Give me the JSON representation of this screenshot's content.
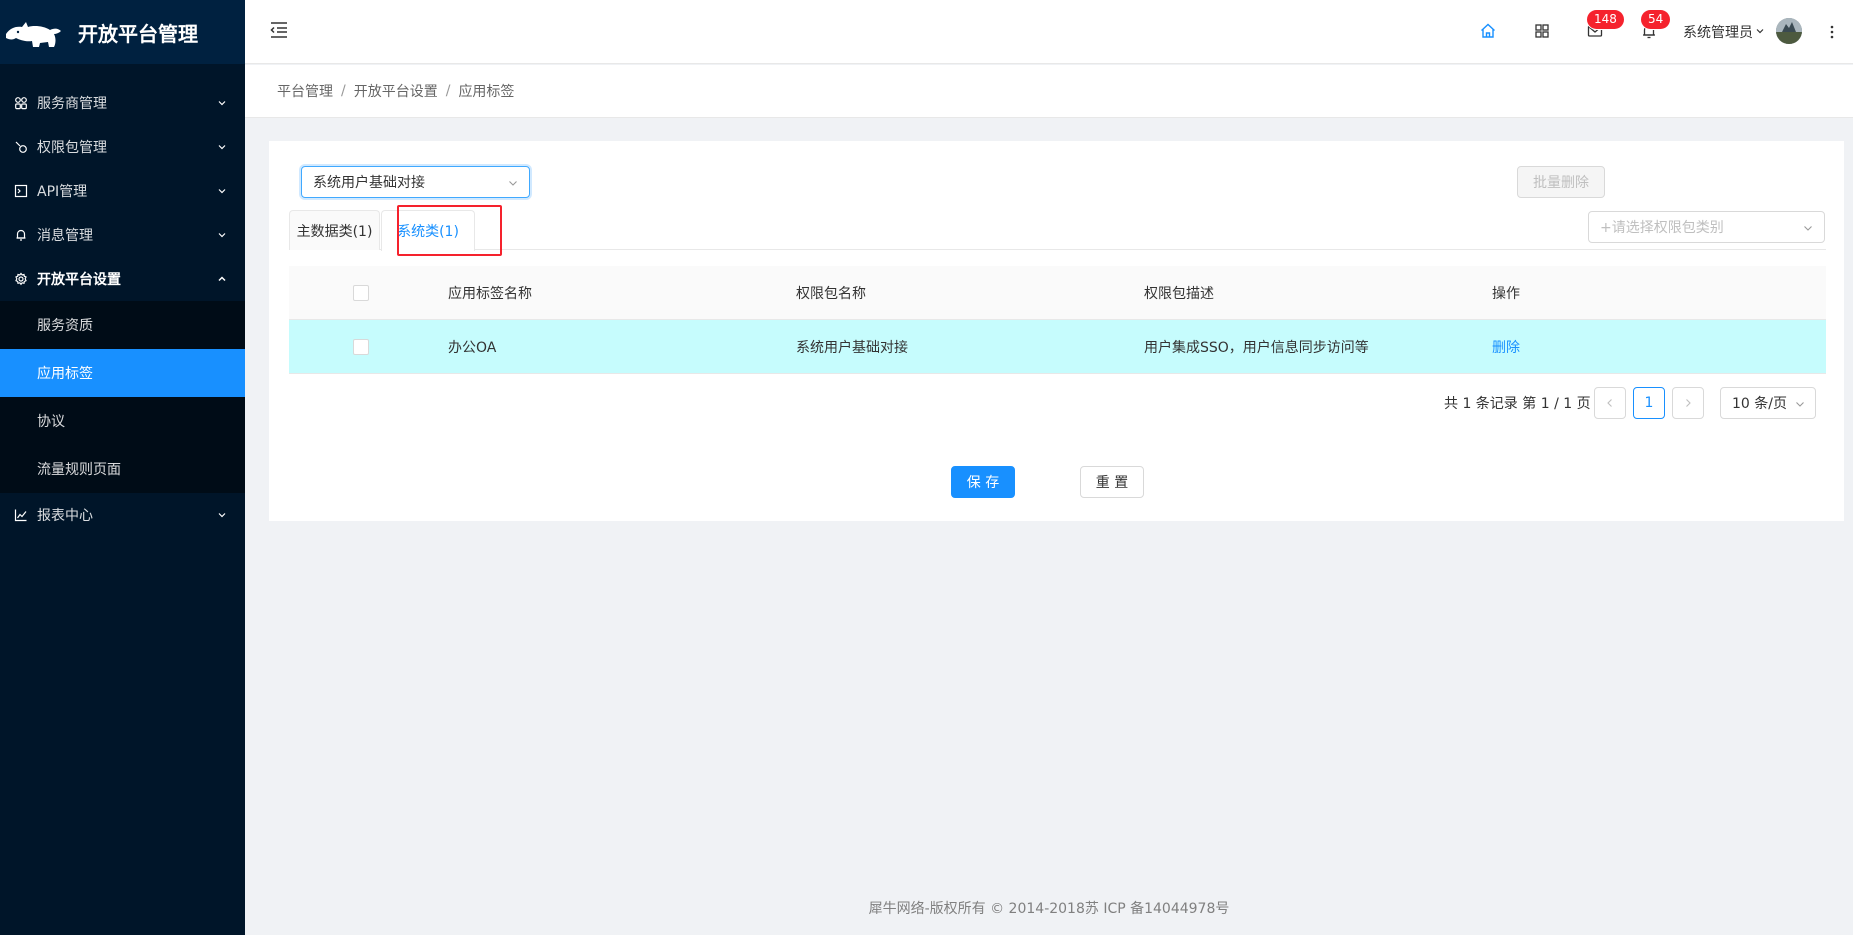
{
  "app": {
    "title": "开放平台管理"
  },
  "sidebar": {
    "items": [
      {
        "label": "服务商管理",
        "icon": "partners-icon"
      },
      {
        "label": "权限包管理",
        "icon": "permission-package-icon"
      },
      {
        "label": "API管理",
        "icon": "api-icon"
      },
      {
        "label": "消息管理",
        "icon": "bell-icon"
      },
      {
        "label": "开放平台设置",
        "icon": "gear-icon",
        "open": true,
        "children": [
          {
            "label": "服务资质"
          },
          {
            "label": "应用标签",
            "active": true
          },
          {
            "label": "协议"
          },
          {
            "label": "流量规则页面"
          }
        ]
      },
      {
        "label": "报表中心",
        "icon": "line-chart-icon"
      }
    ]
  },
  "header": {
    "mail_badge": "148",
    "notice_badge": "54",
    "user_name": "系统管理员"
  },
  "breadcrumb": [
    "平台管理",
    "开放平台设置",
    "应用标签"
  ],
  "filters": {
    "package_select_value": "系统用户基础对接",
    "batch_delete_label": "批量删除",
    "category_placeholder": "+请选择权限包类别"
  },
  "tabs": [
    {
      "label": "主数据类(1)",
      "active": false
    },
    {
      "label": "系统类(1)",
      "active": true
    }
  ],
  "table": {
    "columns": [
      "应用标签名称",
      "权限包名称",
      "权限包描述",
      "操作"
    ],
    "rows": [
      {
        "tag_name": "办公OA",
        "package_name": "系统用户基础对接",
        "description": "用户集成SSO，用户信息同步访问等",
        "action": "删除"
      }
    ]
  },
  "pagination": {
    "summary": "共 1 条记录 第 1 / 1 页",
    "current": "1",
    "page_size": "10 条/页"
  },
  "actions": {
    "save": "保 存",
    "reset": "重 置"
  },
  "footer": {
    "text": "犀牛网络-版权所有 © 2014-2018苏 ICP 备14044978号"
  },
  "colors": {
    "sidebar_bg": "#001529",
    "accent": "#1890ff",
    "selected_row": "#c6fcfd",
    "badge": "#f5222d"
  }
}
